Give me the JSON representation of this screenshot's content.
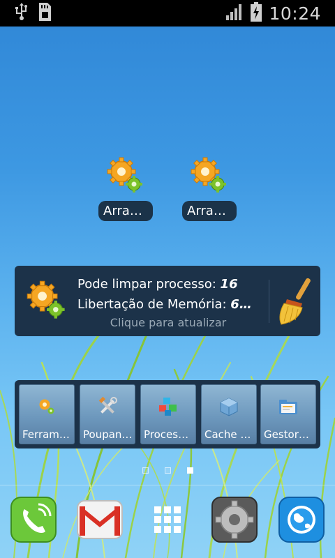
{
  "status_bar": {
    "usb_icon": "usb-icon",
    "sd_icon": "sd-card-icon",
    "signal_icon": "signal-icon",
    "battery_icon": "battery-charging-icon",
    "time": "10:24"
  },
  "shortcuts": [
    {
      "label": "Arran…",
      "icon": "gears-icon"
    },
    {
      "label": "Arran…",
      "icon": "gears-icon"
    }
  ],
  "widget": {
    "line1_label": "Pode limpar processo:",
    "line1_value": "16",
    "line2_label": "Libertação de Memória:",
    "line2_value": "6…",
    "hint": "Clique para atualizar",
    "broom_icon": "broom-icon"
  },
  "toolbar": [
    {
      "label": "Ferrame…",
      "icon": "gears-icon"
    },
    {
      "label": "Poupan…",
      "icon": "tools-icon"
    },
    {
      "label": "Proces…",
      "icon": "blocks-icon"
    },
    {
      "label": "Cache L…",
      "icon": "cube-icon"
    },
    {
      "label": "Gestor…",
      "icon": "folder-icon"
    }
  ],
  "page_indicator": {
    "pages": 3,
    "current": 3
  },
  "dock": [
    {
      "icon": "phone-icon"
    },
    {
      "icon": "gmail-icon"
    },
    {
      "icon": "apps-grid-icon"
    },
    {
      "icon": "settings-icon"
    },
    {
      "icon": "browser-icon"
    }
  ]
}
